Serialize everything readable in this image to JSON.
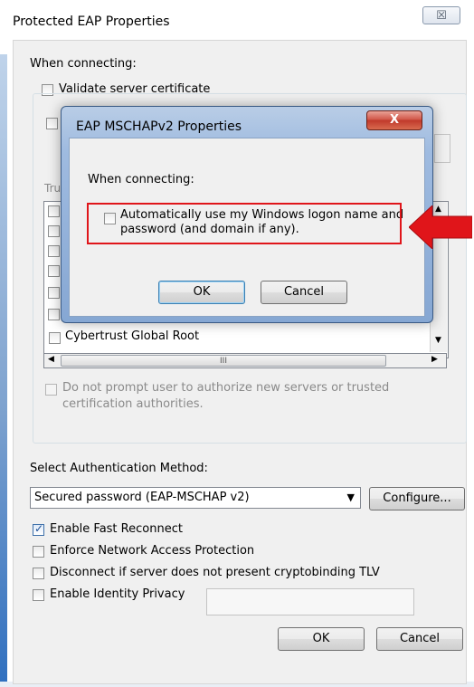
{
  "outer": {
    "title": "Protected EAP Properties",
    "close_glyph": "☒",
    "when_connecting": "When connecting:",
    "validate_cert": "Validate server certificate",
    "trusted_label_partial": "Tru",
    "list_visible_item": "Cybertrust Global Root",
    "scroll_thumb_grip": "III",
    "no_prompt_line1": "Do not prompt user to authorize new servers or trusted",
    "no_prompt_line2": "certification authorities.",
    "select_auth_label": "Select Authentication Method:",
    "auth_method_value": "Secured password (EAP-MSCHAP v2)",
    "configure_button": "Configure...",
    "enable_fast_reconnect": "Enable Fast Reconnect",
    "enforce_nap": "Enforce Network Access Protection",
    "disconnect_crypto": "Disconnect if server does not present cryptobinding TLV",
    "enable_identity_privacy": "Enable Identity Privacy",
    "ok_button": "OK",
    "cancel_button": "Cancel"
  },
  "inner": {
    "title": "EAP MSCHAPv2 Properties",
    "close_glyph": "X",
    "when_connecting": "When connecting:",
    "auto_logon_line1": "Automatically use my Windows logon name and",
    "auto_logon_line2": "password (and domain if any).",
    "ok_button": "OK",
    "cancel_button": "Cancel"
  },
  "states": {
    "validate_cert_checked": false,
    "auto_logon_checked": false,
    "fast_reconnect_checked": true,
    "enforce_nap_checked": false,
    "disconnect_crypto_checked": false,
    "identity_privacy_checked": false
  },
  "colors": {
    "highlight_border": "#e0151a",
    "arrow_fill": "#e0151a",
    "inner_frame": "#86a7d3"
  }
}
